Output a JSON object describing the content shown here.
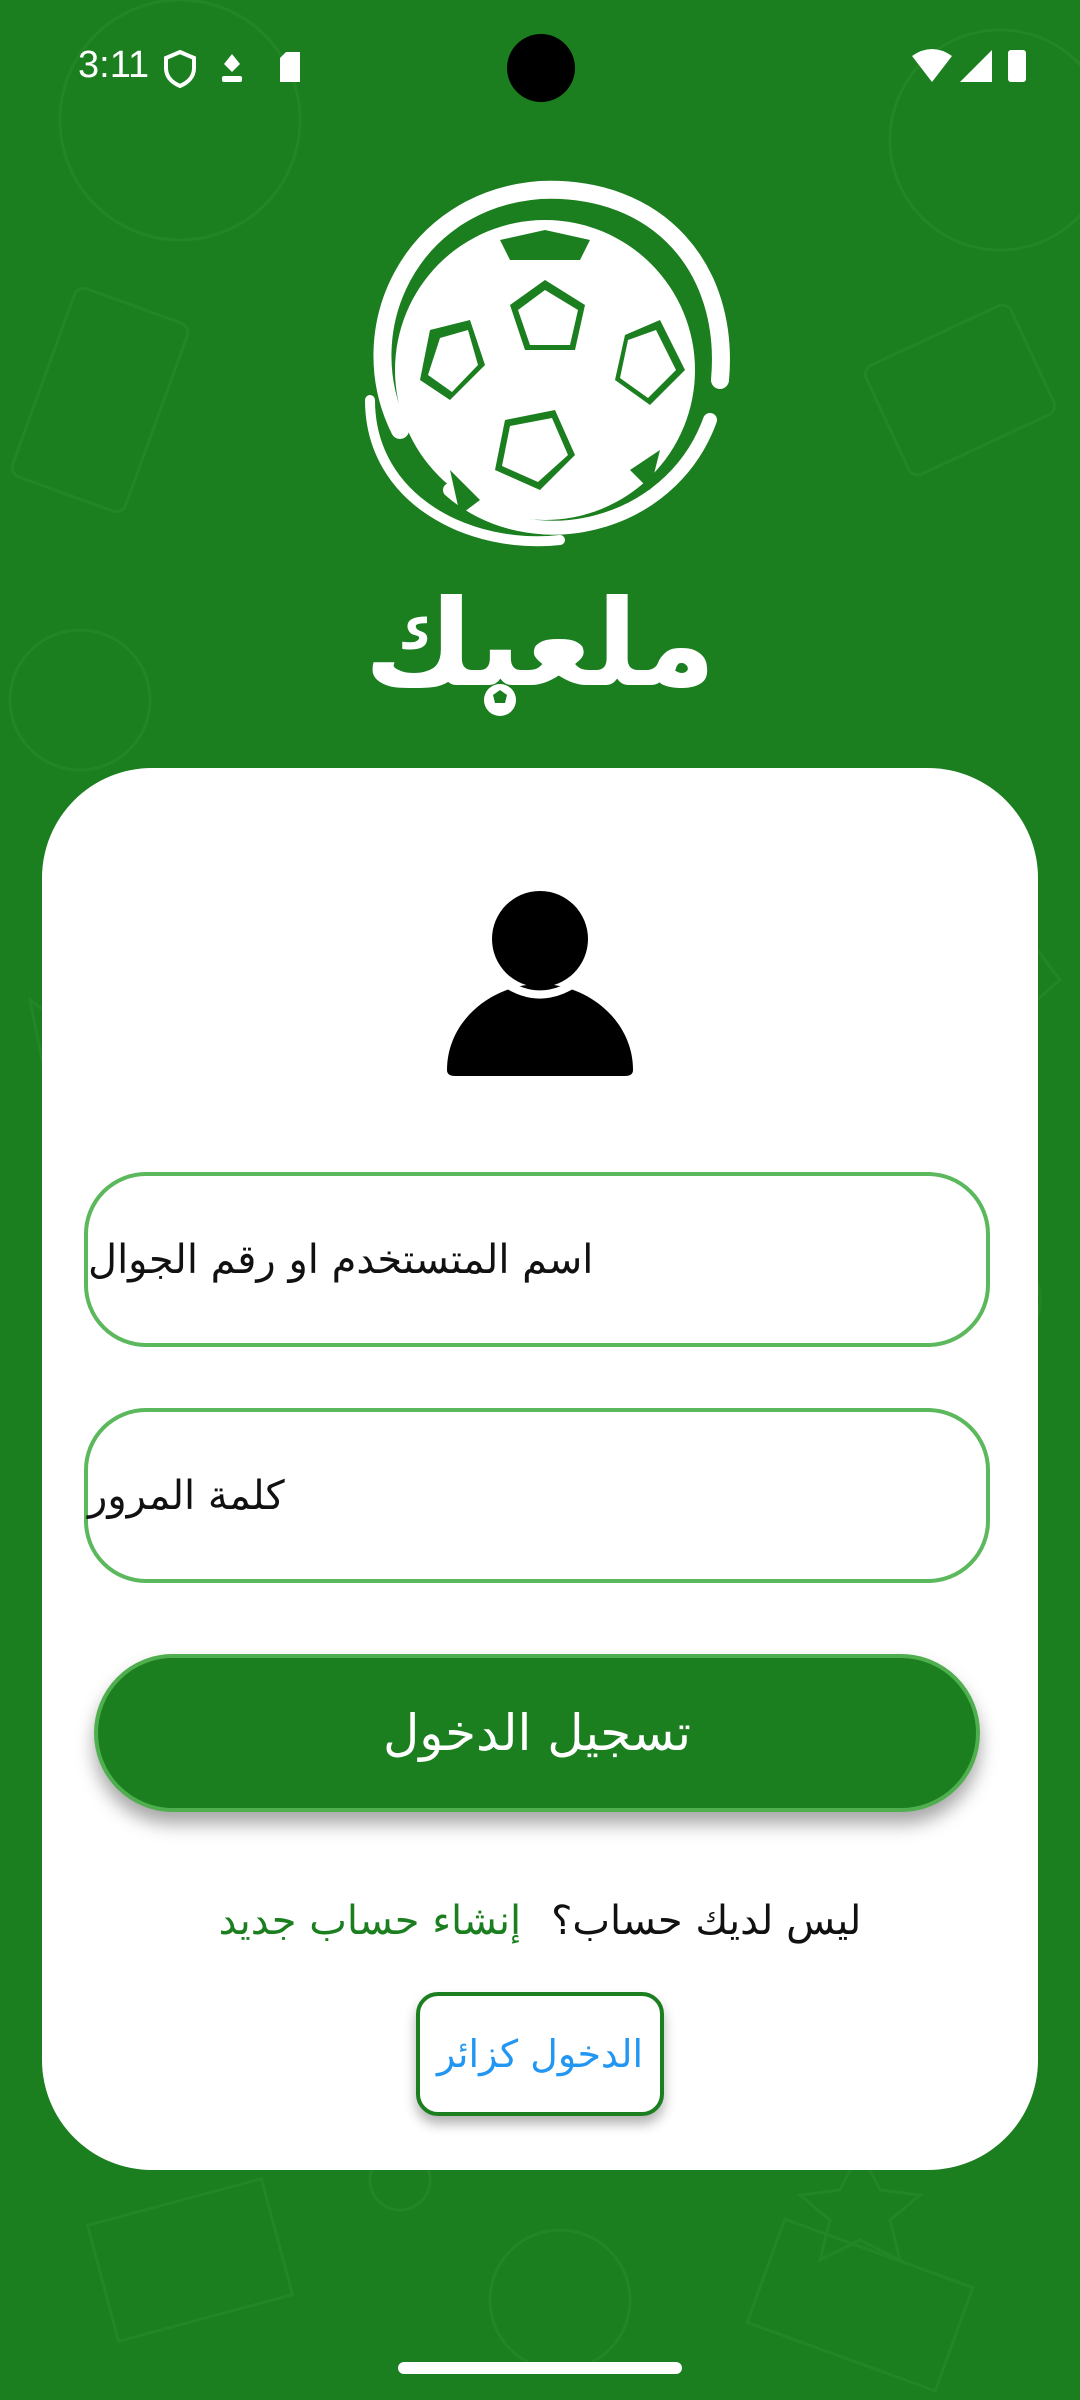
{
  "status_bar": {
    "time": "3:11",
    "icons_left": [
      "shield-icon",
      "location-icon",
      "sd-card-icon"
    ],
    "icons_right": [
      "wifi-icon",
      "signal-icon",
      "battery-icon"
    ]
  },
  "branding": {
    "app_name": "ملعبك",
    "logo_icon": "soccer-ball-icon"
  },
  "form": {
    "avatar_icon": "user-avatar-icon",
    "username_placeholder": "اسم المتستخدم او رقم الجوال",
    "password_placeholder": "كلمة المرور",
    "login_label": "تسجيل الدخول",
    "no_account_text": "ليس لديك حساب؟",
    "signup_link": "إنشاء حساب جديد",
    "guest_label": "الدخول كزائر"
  },
  "colors": {
    "primary_green": "#1b7e1f",
    "field_border": "#5cb85c",
    "guest_text": "#2196f3"
  }
}
